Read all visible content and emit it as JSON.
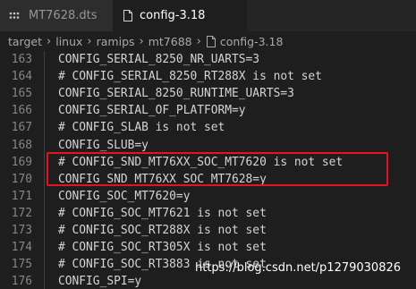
{
  "tabs": [
    {
      "label": "MT7628.dts",
      "active": false,
      "icon": "dots-icon"
    },
    {
      "label": "config-3.18",
      "active": true,
      "icon": "file-icon"
    }
  ],
  "breadcrumb": [
    "target",
    "linux",
    "ramips",
    "mt7688",
    "config-3.18"
  ],
  "lines": [
    {
      "num": "163",
      "text": "CONFIG_SERIAL_8250_NR_UARTS=3"
    },
    {
      "num": "164",
      "text": "# CONFIG_SERIAL_8250_RT288X is not set"
    },
    {
      "num": "165",
      "text": "CONFIG_SERIAL_8250_RUNTIME_UARTS=3"
    },
    {
      "num": "166",
      "text": "CONFIG_SERIAL_OF_PLATFORM=y"
    },
    {
      "num": "167",
      "text": "# CONFIG_SLAB is not set"
    },
    {
      "num": "168",
      "text": "CONFIG_SLUB=y"
    },
    {
      "num": "169",
      "text": "# CONFIG_SND_MT76XX_SOC_MT7620 is not set"
    },
    {
      "num": "170",
      "text": "CONFIG_SND_MT76XX_SOC_MT7628=y"
    },
    {
      "num": "171",
      "text": "CONFIG_SOC_MT7620=y"
    },
    {
      "num": "172",
      "text": "# CONFIG_SOC_MT7621 is not set"
    },
    {
      "num": "173",
      "text": "# CONFIG_SOC_RT288X is not set"
    },
    {
      "num": "174",
      "text": "# CONFIG_SOC_RT305X is not set"
    },
    {
      "num": "175",
      "text": "# CONFIG_SOC_RT3883 is not set"
    },
    {
      "num": "176",
      "text": "CONFIG_SPI=y"
    }
  ],
  "watermark": "https://blog.csdn.net/p1279030826",
  "colors": {
    "highlight_border": "#e81123",
    "editor_bg": "#1e1e1e",
    "line_number": "#858585"
  }
}
